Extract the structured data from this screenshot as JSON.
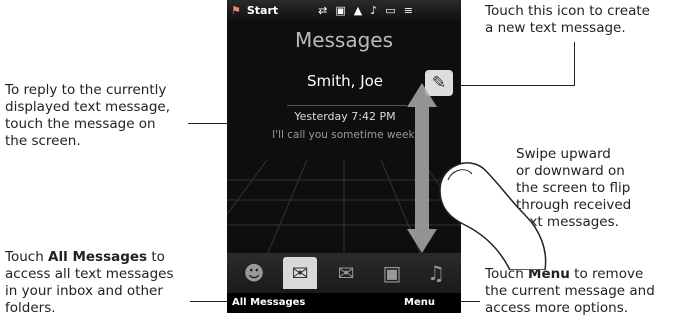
{
  "phone": {
    "status": {
      "start_label": "Start"
    },
    "title": "Messages",
    "message": {
      "sender": "Smith, Joe",
      "time": "Yesterday 7:42 PM",
      "preview": "I'll call you sometime week."
    },
    "tabs": [
      {
        "icon": "person-icon"
      },
      {
        "icon": "message-icon"
      },
      {
        "icon": "envelope-icon"
      },
      {
        "icon": "camera-icon"
      },
      {
        "icon": "music-icon"
      }
    ],
    "softkeys": {
      "left": "All Messages",
      "right": "Menu"
    }
  },
  "callouts": {
    "new_message": [
      "Touch this icon to create",
      "a new text message."
    ],
    "reply": [
      "To reply to the currently",
      "displayed text message,",
      "touch the message on",
      "the screen."
    ],
    "swipe": [
      "Swipe upward",
      "or downward on",
      "the screen to flip",
      "through received",
      "text messages."
    ],
    "all_messages_bold": "All Messages",
    "all_messages": [
      "Touch ",
      " to",
      "access all text messages",
      "in your inbox and other",
      "folders."
    ],
    "menu_bold": "Menu",
    "menu": [
      "Touch ",
      " to remove",
      "the current message and",
      "access more options."
    ]
  }
}
